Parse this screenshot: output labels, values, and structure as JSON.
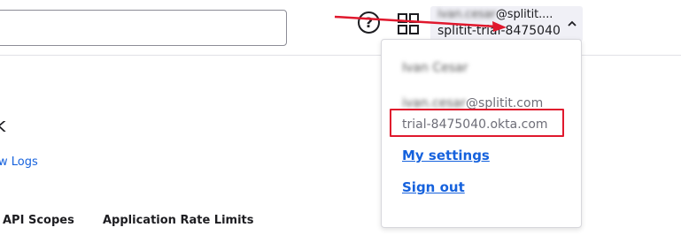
{
  "header": {
    "search_value": "",
    "help_icon": "question-circle-icon",
    "apps_icon": "grid-icon",
    "user_menu": {
      "email_blurred_part": "ivan.cesar",
      "email_visible_part": "@splitit....",
      "org": "splitit-trial-8475040",
      "chevron_icon": "chevron-up-icon"
    }
  },
  "dropdown": {
    "name_blurred": "Ivan Cesar",
    "email_blurred_part": "ivan.cesar",
    "email_visible_part": "@splitit.com",
    "domain": "trial-8475040.okta.com",
    "settings_label": "My settings",
    "signout_label": "Sign out"
  },
  "page": {
    "heading_fragment": "k",
    "logs_link": "w Logs",
    "tabs": [
      {
        "label": "API Scopes"
      },
      {
        "label": "Application Rate Limits"
      }
    ]
  },
  "colors": {
    "link": "#1662dd",
    "annotation": "#e0182d",
    "user_menu_bg": "#f0f0f6"
  }
}
